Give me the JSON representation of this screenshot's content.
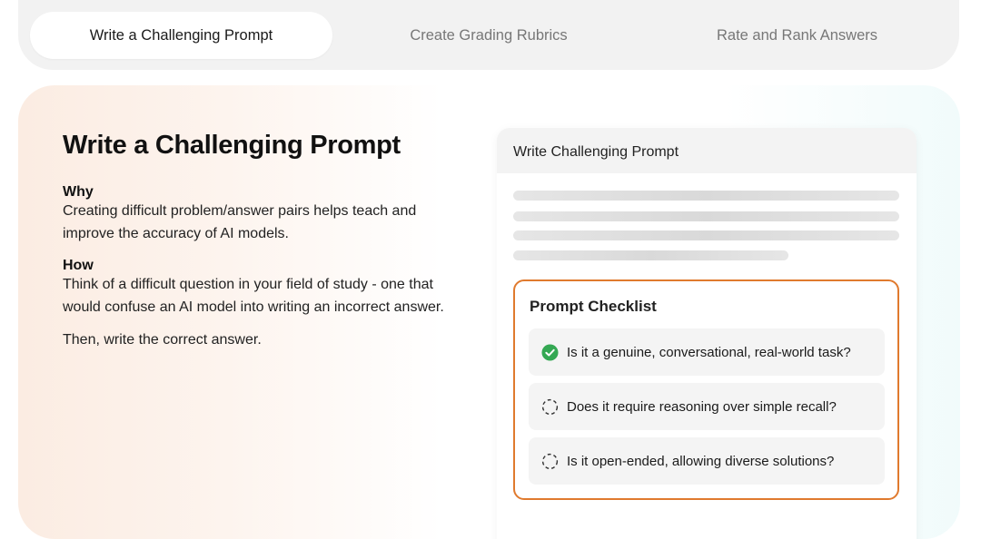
{
  "tabs": [
    {
      "label": "Write a Challenging Prompt",
      "active": true
    },
    {
      "label": "Create Grading Rubrics",
      "active": false
    },
    {
      "label": "Rate and Rank Answers",
      "active": false
    }
  ],
  "main": {
    "title": "Write a Challenging Prompt",
    "why_heading": "Why",
    "why_text": "Creating difficult problem/answer pairs helps teach and improve the accuracy of AI models.",
    "how_heading": "How",
    "how_text": "Think of a difficult question in your field of study - one that would confuse an AI model into writing an incorrect answer.",
    "then_text": "Then, write the correct answer."
  },
  "card": {
    "title": "Write Challenging Prompt",
    "checklist": {
      "title": "Prompt Checklist",
      "items": [
        {
          "label": "Is it a genuine, conversational, real-world task?",
          "icon": "check-circle-icon",
          "checked": true
        },
        {
          "label": "Does it require reasoning over simple recall?",
          "icon": "dashed-circle-icon",
          "checked": false
        },
        {
          "label": "Is it open-ended, allowing diverse solutions?",
          "icon": "dashed-circle-icon",
          "checked": false
        }
      ]
    }
  },
  "colors": {
    "accent_orange": "#e07a2e",
    "check_green": "#34a853"
  }
}
